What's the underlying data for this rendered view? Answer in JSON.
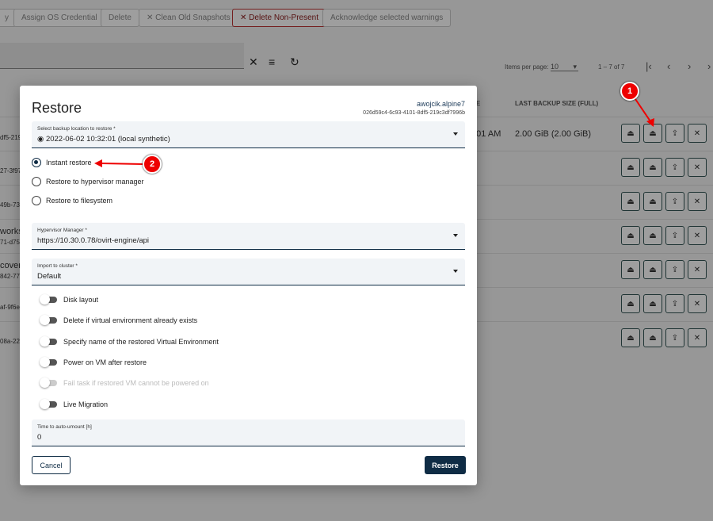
{
  "toolbar": {
    "buttons": [
      "y",
      "Assign OS Credential",
      "Delete",
      "Clean Old Snapshots",
      "Delete Non-Present",
      "Acknowledge selected warnings"
    ]
  },
  "pagination": {
    "items_per_page_label": "Items per page:",
    "items_per_page": "10",
    "range": "1 – 7 of 7"
  },
  "table": {
    "headers": [
      "TE",
      "LAST BACKUP SIZE (FULL)"
    ],
    "rows": [
      {
        "name": "",
        "id": "df5-219c",
        "date": "2:01 AM",
        "size": "2.00 GiB (2.00 GiB)"
      },
      {
        "name": "",
        "id": "27-3f97"
      },
      {
        "name": "",
        "id": "49b-73a"
      },
      {
        "name": "worksh",
        "id": "71-d754"
      },
      {
        "name": "covery",
        "id": "842-774"
      },
      {
        "name": "",
        "id": "af-9f6e"
      },
      {
        "name": "",
        "id": "08a-22b"
      }
    ]
  },
  "dialog": {
    "title": "Restore",
    "vm_name": "awojcik.alpine7",
    "vm_id": "026d59c4-6c93-4101-8df5-219c3df7996b",
    "backup_location": {
      "label": "Select backup location to restore *",
      "value": "2022-06-02 10:32:01 (local synthetic)"
    },
    "restore_options": [
      {
        "label": "Instant restore",
        "selected": true
      },
      {
        "label": "Restore to hypervisor manager",
        "selected": false
      },
      {
        "label": "Restore to filesystem",
        "selected": false
      }
    ],
    "hypervisor": {
      "label": "Hypervisor Manager *",
      "value": "https://10.30.0.78/ovirt-engine/api"
    },
    "cluster": {
      "label": "Import to cluster *",
      "value": "Default"
    },
    "toggles": [
      {
        "label": "Disk layout",
        "on": false,
        "disabled": false
      },
      {
        "label": "Delete if virtual environment already exists",
        "on": false,
        "disabled": false
      },
      {
        "label": "Specify name of the restored Virtual Environment",
        "on": false,
        "disabled": false
      },
      {
        "label": "Power on VM after restore",
        "on": false,
        "disabled": false
      },
      {
        "label": "Fail task if restored VM cannot be powered on",
        "on": false,
        "disabled": true
      },
      {
        "label": "Live Migration",
        "on": false,
        "disabled": false
      }
    ],
    "auto_unmount": {
      "label": "Time to auto-umount [h]",
      "value": "0"
    },
    "cancel": "Cancel",
    "restore": "Restore"
  },
  "annotations": [
    "1",
    "2"
  ],
  "colors": {
    "primary": "#0f2c45",
    "danger": "#b33333",
    "annotation": "#e00000"
  }
}
